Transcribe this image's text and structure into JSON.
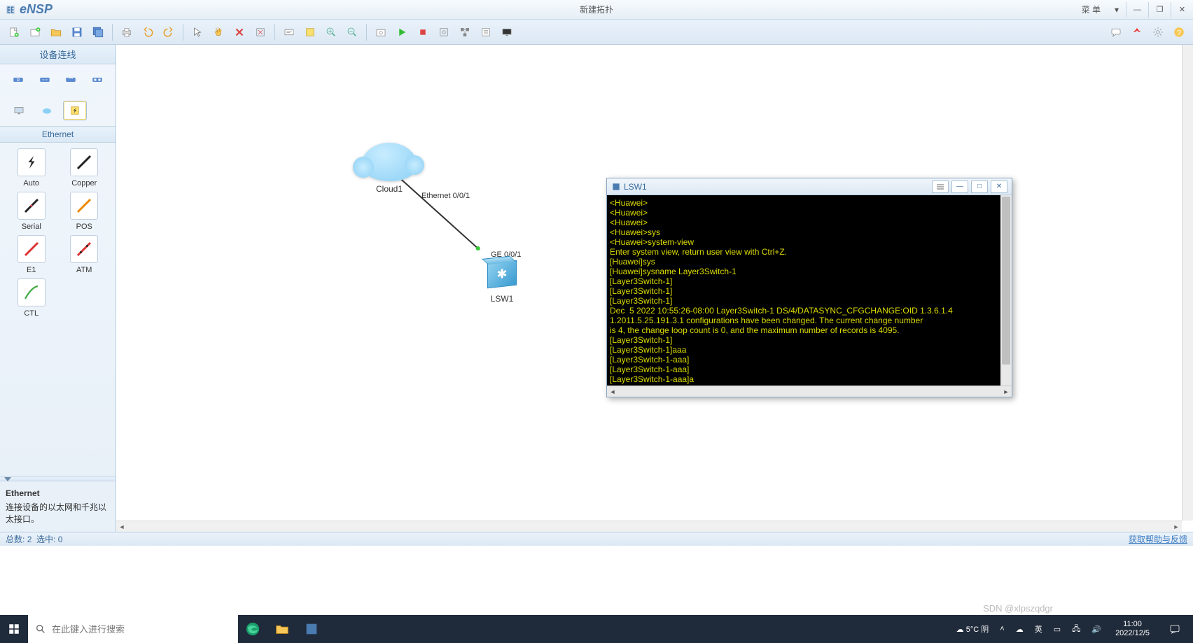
{
  "app": {
    "name": "eNSP",
    "doc_title": "新建拓扑"
  },
  "titlebar": {
    "menu": "菜  单"
  },
  "sidebar": {
    "title": "设备连线",
    "subtitle": "Ethernet",
    "tools": [
      {
        "label": "Auto"
      },
      {
        "label": "Copper"
      },
      {
        "label": "Serial"
      },
      {
        "label": "POS"
      },
      {
        "label": "E1"
      },
      {
        "label": "ATM"
      },
      {
        "label": "CTL"
      }
    ],
    "desc_title": "Ethernet",
    "desc_body": "连接设备的以太网和千兆以太接口。"
  },
  "topology": {
    "cloud": "Cloud1",
    "switch": "LSW1",
    "port_cloud": "Ethernet 0/0/1",
    "port_switch": "GE 0/0/1"
  },
  "cli": {
    "title": "LSW1",
    "lines": [
      "<Huawei>",
      "<Huawei>",
      "<Huawei>",
      "<Huawei>sys",
      "<Huawei>system-view",
      "Enter system view, return user view with Ctrl+Z.",
      "[Huawei]sys",
      "[Huawei]sysname Layer3Switch-1",
      "[Layer3Switch-1]",
      "[Layer3Switch-1]",
      "[Layer3Switch-1]",
      "Dec  5 2022 10:55:26-08:00 Layer3Switch-1 DS/4/DATASYNC_CFGCHANGE:OID 1.3.6.1.4",
      "1.2011.5.25.191.3.1 configurations have been changed. The current change number",
      "is 4, the change loop count is 0, and the maximum number of records is 4095.",
      "[Layer3Switch-1]",
      "[Layer3Switch-1]aaa",
      "[Layer3Switch-1-aaa]",
      "[Layer3Switch-1-aaa]",
      "[Layer3Switch-1-aaa]a"
    ]
  },
  "status": {
    "total_label": "总数:",
    "total": "2",
    "sel_label": "选中:",
    "sel": "0",
    "help": "获取帮助与反馈"
  },
  "taskbar": {
    "search_placeholder": "在此键入进行搜索",
    "weather": "5°C 阴",
    "ime": "英",
    "time": "11:00",
    "date": "2022/12/5"
  },
  "watermark": "SDN @xlpszqdgr"
}
